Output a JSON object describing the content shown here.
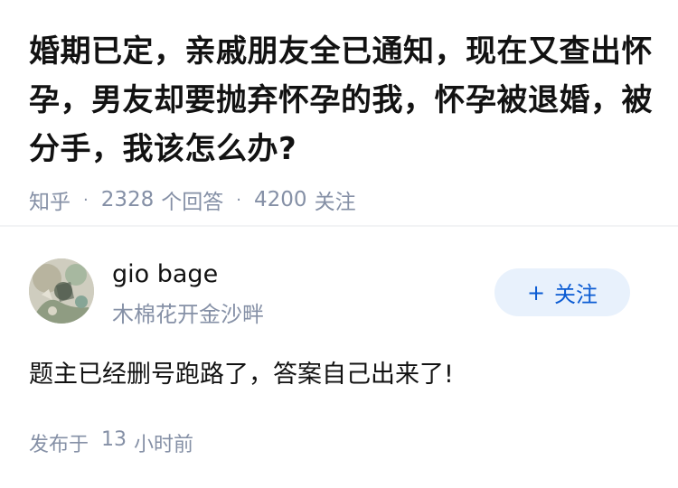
{
  "question": {
    "title": "婚期已定，亲戚朋友全已通知，现在又查出怀孕，男友却要抛弃怀孕的我，怀孕被退婚，被分手，我该怎么办?",
    "source": "知乎",
    "separator": "·",
    "answer_count": "2328",
    "answer_label": "个回答",
    "follower_count": "4200",
    "follower_label": "关注"
  },
  "author": {
    "avatar_icon": "avatar-image",
    "name": "gio bage",
    "bio": "木棉花开金沙畔",
    "follow_icon": "plus-icon",
    "follow_plus": "+",
    "follow_label": "关注",
    "follow_color": "#0a5bd3",
    "follow_bg": "#e8f1fc"
  },
  "answer": {
    "text": "题主已经删号跑路了，答案自己出来了!",
    "published_label": "发布于",
    "published_num": "13",
    "published_unit": "小时前"
  }
}
